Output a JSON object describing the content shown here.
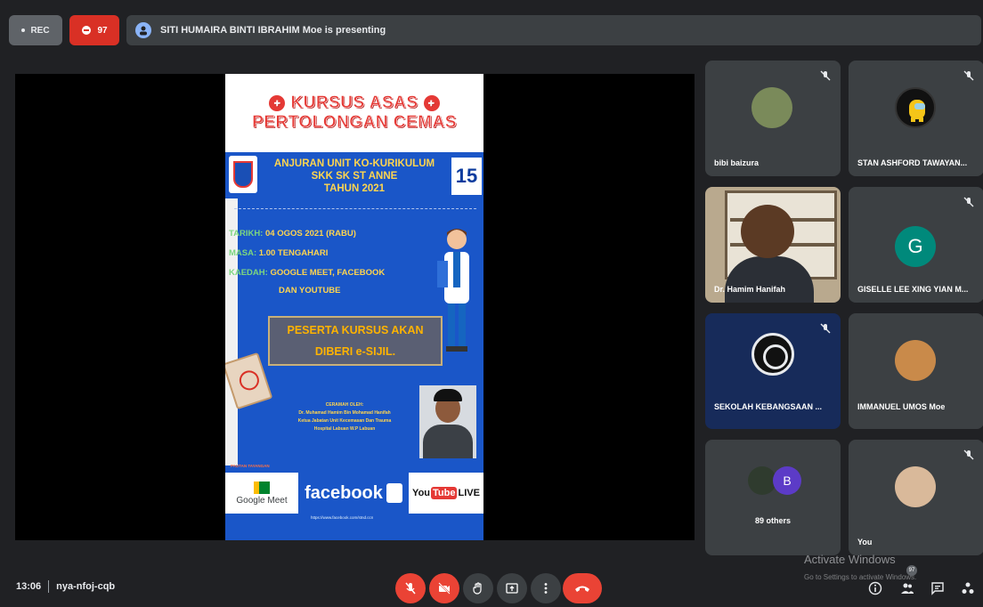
{
  "topbar": {
    "rec_label": "REC",
    "participant_count": "97",
    "presenting_text": "SITI HUMAIRA BINTI IBRAHIM Moe is presenting"
  },
  "poster": {
    "title_line1": "KURSUS ASAS",
    "title_line2": "PERTOLONGAN CEMAS",
    "org_line1": "ANJURAN UNIT KO-KURIKULUM",
    "org_line2": "SKK SK ST ANNE",
    "org_line3": "TAHUN 2021",
    "badge": "15",
    "tarikh_label": "TARIKH:",
    "tarikh_value": "04 OGOS 2021 (RABU)",
    "masa_label": "MASA:",
    "masa_value": "1.00 TENGAHARI",
    "kaedah_label": "KAEDAH:",
    "kaedah_value": "GOOGLE MEET, FACEBOOK",
    "kaedah_value2": "DAN YOUTUBE",
    "peserta_line1": "PESERTA KURSUS AKAN",
    "peserta_line2": "DIBERI e-SIJIL.",
    "ceramah_line1": "CERAMAH OLEH:",
    "ceramah_line2": "Dr. Muhamad Hamim Bin Mohamad Hanifah",
    "ceramah_line3": "Ketua Jabatan Unit Kecemasan Dan Trauma",
    "ceramah_line4": "Hospital Labuan W.P Labuan",
    "pautan": "PAUTAN TAYANGAN",
    "google_meet": "Google Meet",
    "facebook": "facebook",
    "youtube_a": "You",
    "youtube_b": "Tube",
    "youtube_c": "LIVE",
    "fb_url": "https://www.facebook.com/stnd.ccn"
  },
  "tiles": [
    {
      "name": "bibi baizura"
    },
    {
      "name": "STAN ASHFORD TAWAYAN..."
    },
    {
      "name": "Dr. Hamim Hanifah"
    },
    {
      "name": "GISELLE LEE XING YIAN M...",
      "letter": "G"
    },
    {
      "name": "SEKOLAH KEBANGSAAN ..."
    },
    {
      "name": "IMMANUEL UMOS Moe"
    },
    {
      "name": "89 others",
      "letter": "B"
    },
    {
      "name": "You"
    }
  ],
  "bottombar": {
    "time": "13:06",
    "meeting_code": "nya-nfoj-cqb",
    "people_badge": "97"
  },
  "watermark": {
    "title": "Activate Windows",
    "subtitle": "Go to Settings to activate Windows."
  },
  "colors": {
    "background": "#202124",
    "tile": "#3c4043",
    "danger": "#ea4335",
    "poster_blue": "#1a56c8"
  }
}
